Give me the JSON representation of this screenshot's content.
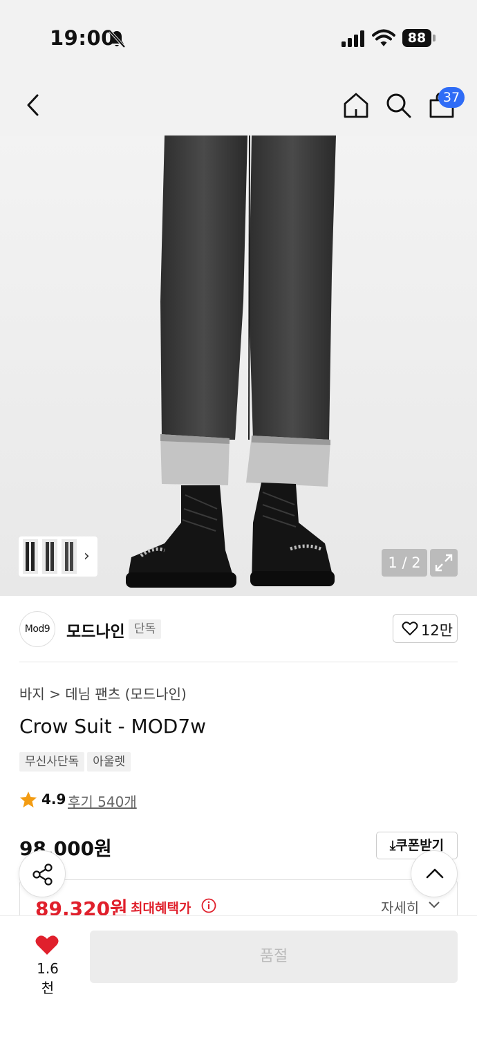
{
  "status_bar": {
    "time": "19:00",
    "battery": "88",
    "icons": [
      "bell-slash-icon",
      "signal-icon",
      "wifi-icon",
      "battery-icon"
    ]
  },
  "header": {
    "icons": [
      "back-icon",
      "home-icon",
      "search-icon",
      "bag-icon"
    ],
    "cart_badge": "37"
  },
  "gallery": {
    "page_indicator": "1 / 2",
    "thumbnail_chevron": "›",
    "icons": [
      "expand-icon",
      "chevron-right-icon"
    ]
  },
  "brand": {
    "logo_text": "Mod9",
    "name": "모드나인",
    "tag": "단독",
    "like_count": "12만"
  },
  "product": {
    "breadcrumb": "바지 > 데님 팬츠 (모드나인)",
    "title": "Crow Suit - MOD7w",
    "tags": [
      "무신사단독",
      "아울렛"
    ],
    "rating": "4.9",
    "reviews": "후기 540개",
    "price": "98,000원",
    "coupon_label": "쿠폰받기",
    "benefit_price": "89,320원",
    "benefit_label": "최대혜택가",
    "detail_label": "자세히"
  },
  "bottom_bar": {
    "wish_count": "1.6천",
    "purchase_label": "품절",
    "accent_color": "#e0202c"
  },
  "colors": {
    "badge": "#2f6cf6",
    "price_red": "#e0202c",
    "star": "#f39c12"
  }
}
